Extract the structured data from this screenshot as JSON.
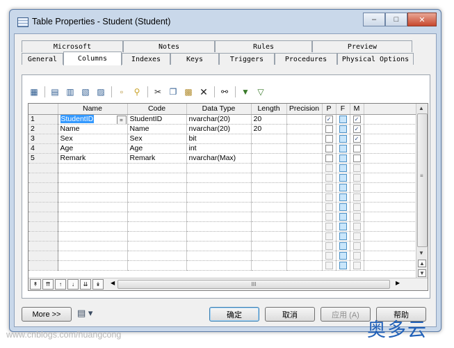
{
  "window": {
    "title": "Table Properties - Student (Student)"
  },
  "tabs": {
    "row1": [
      "Microsoft",
      "Notes",
      "Rules",
      "Preview"
    ],
    "row2": [
      "General",
      "Columns",
      "Indexes",
      "Keys",
      "Triggers",
      "Procedures",
      "Physical Options"
    ],
    "active": "Columns"
  },
  "toolbar": {
    "icons": [
      "properties-icon",
      "add-row-icon",
      "insert-row-icon",
      "add-rows-icon",
      "delete-rows-icon",
      "clipboard-icon",
      "key-icon",
      "cut-icon",
      "copy-icon",
      "paste-icon",
      "delete-icon",
      "find-icon",
      "filter-icon",
      "clear-filter-icon"
    ]
  },
  "grid": {
    "headers": [
      "Name",
      "Code",
      "Data Type",
      "Length",
      "Precision",
      "P",
      "F",
      "M"
    ],
    "rows": [
      {
        "num": "1",
        "name": "StudentID",
        "code": "StudentID",
        "type": "nvarchar(20)",
        "length": "20",
        "precision": "",
        "p": "✓",
        "f": "",
        "m": "✓"
      },
      {
        "num": "2",
        "name": "Name",
        "code": "Name",
        "type": "nvarchar(20)",
        "length": "20",
        "precision": "",
        "p": "",
        "f": "",
        "m": "✓"
      },
      {
        "num": "3",
        "name": "Sex",
        "code": "Sex",
        "type": "bit",
        "length": "",
        "precision": "",
        "p": "",
        "f": "",
        "m": "✓"
      },
      {
        "num": "4",
        "name": "Age",
        "code": "Age",
        "type": "int",
        "length": "",
        "precision": "",
        "p": "",
        "f": "",
        "m": ""
      },
      {
        "num": "5",
        "name": "Remark",
        "code": "Remark",
        "type": "nvarchar(Max)",
        "length": "",
        "precision": "",
        "p": "",
        "f": "",
        "m": ""
      }
    ],
    "selected_cell_button": "=",
    "scroll_thumb_label": "III"
  },
  "buttons": {
    "more": "More >>",
    "ok": "确定",
    "cancel": "取消",
    "apply": "应用 (A)",
    "help": "帮助"
  },
  "footer": {
    "watermark": "www.cnblogs.com/huangcong",
    "brand": "奥多云"
  }
}
